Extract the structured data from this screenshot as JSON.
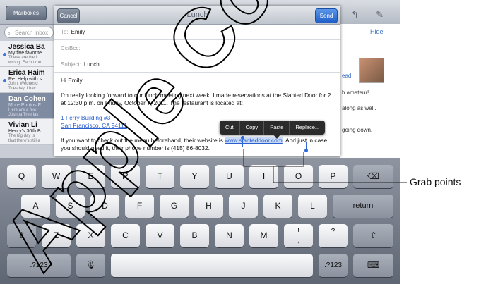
{
  "mail": {
    "mailboxes_label": "Mailboxes",
    "search_placeholder": "Search Inbox",
    "hide_label": "Hide",
    "messages": [
      {
        "from": "Jessica Ba",
        "subject": "My five favorite",
        "preview1": "These are the f",
        "preview2": "wrong. Each time",
        "unread": true,
        "selected": false
      },
      {
        "from": "Erica Haim",
        "subject": "Re: Help with s",
        "preview1": "John, Wednesd",
        "preview2": "Tuesday. I hav",
        "unread": true,
        "selected": false
      },
      {
        "from": "Dan Cohen",
        "subject": "More Photos F",
        "preview1": "Here are a few",
        "preview2": "Joshua Tree las",
        "unread": false,
        "selected": true
      },
      {
        "from": "Vivian Li",
        "subject": "Henry's 30th B",
        "preview1": "The big day is",
        "preview2": "that there's still a",
        "unread": false,
        "selected": false
      }
    ],
    "right_link": "ead",
    "right_text1": "h amateur!",
    "right_text2": "along as well.",
    "right_text3": "going down."
  },
  "compose": {
    "cancel_label": "Cancel",
    "title": "Lunch",
    "send_label": "Send",
    "to_label": "To:",
    "to_value": "Emily",
    "cc_label": "Cc/Bcc:",
    "subject_label": "Subject:",
    "subject_value": "Lunch",
    "greeting": "Hi Emily,",
    "para1": "I'm really looking forward to our lunch meeting next week. I made reservations at the Slanted Door for 2 at 12:30 p.m. on Friday, October 7, 2011. The restaurant is located at:",
    "address_line1": "1 Ferry Building #3",
    "address_line2": "San Francisco, CA 94111",
    "para2_start": "If you want to check out the menu beforehand, their website is ",
    "website": "www.slanteddoor.com",
    "para2_mid": ". And just in case you should need it, their phone number is (415) 86",
    "para2_end": "-8032."
  },
  "edit_menu": [
    "Cut",
    "Copy",
    "Paste",
    "Replace..."
  ],
  "keyboard": {
    "row1": [
      "Q",
      "W",
      "E",
      "R",
      "T",
      "Y",
      "U",
      "I",
      "O",
      "P"
    ],
    "row2": [
      "A",
      "S",
      "D",
      "F",
      "G",
      "H",
      "J",
      "K",
      "L"
    ],
    "row3": [
      "Z",
      "X",
      "C",
      "V",
      "B",
      "N",
      "M"
    ],
    "excl_top": "!",
    "excl_bottom": ",",
    "quest_top": "?",
    "quest_bottom": ".",
    "return_label": "return",
    "numbers_label": ".?123",
    "numbers_label_right": ".?123"
  },
  "callout": "Grab points",
  "watermark": "Apple Confidential"
}
